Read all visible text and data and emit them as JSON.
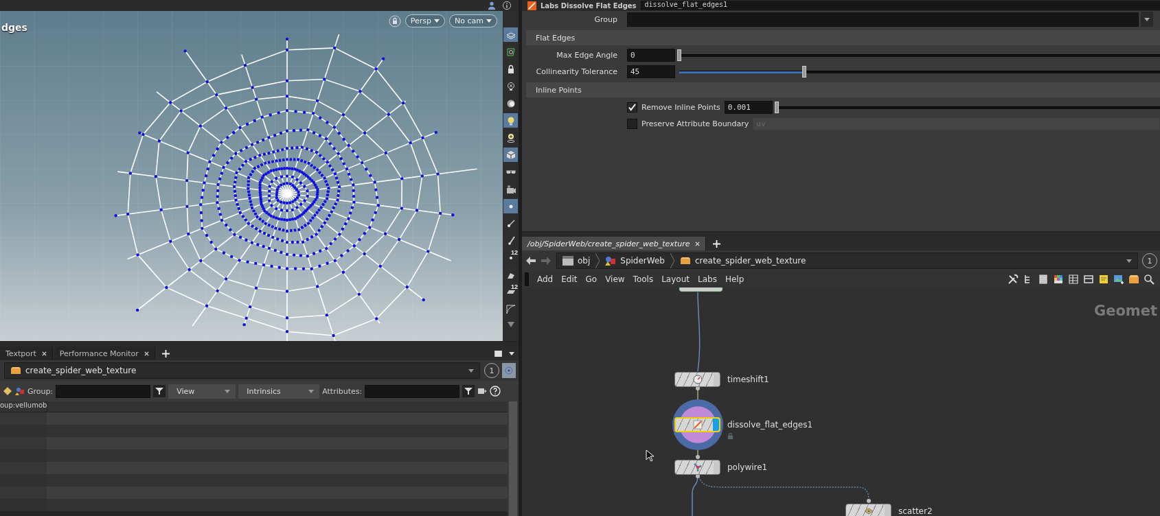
{
  "viewport": {
    "title": "dges",
    "view_menus": [
      {
        "label": "Persp"
      },
      {
        "label": "No cam"
      }
    ],
    "tools": [
      {
        "kind": "layers",
        "selected": true
      },
      {
        "kind": "snap",
        "selected": false
      },
      {
        "kind": "lock",
        "selected": false
      },
      {
        "kind": "bulb-x",
        "selected": false
      },
      {
        "kind": "sphere",
        "selected": false
      },
      {
        "kind": "bulb",
        "selected": true
      },
      {
        "kind": "bulb-plus",
        "selected": false
      },
      {
        "kind": "cube",
        "selected": true
      },
      {
        "kind": "glasses",
        "selected": false
      },
      {
        "kind": "camera",
        "selected": false
      },
      {
        "kind": "point",
        "selected": true
      },
      {
        "kind": "vertex",
        "selected": false
      },
      {
        "kind": "normal",
        "selected": false
      },
      {
        "kind": "point-numbers",
        "selected": false,
        "label": "12"
      },
      {
        "kind": "polygon",
        "selected": false
      },
      {
        "kind": "polygon-numbers",
        "selected": false,
        "label": "12"
      },
      {
        "kind": "curve",
        "selected": false
      }
    ]
  },
  "spreadsheet": {
    "tabs": [
      {
        "label": "Textport",
        "selected": false
      },
      {
        "label": "Performance Monitor",
        "selected": false
      }
    ],
    "path": "create_spider_web_texture",
    "badge": "1",
    "group_label": "Group:",
    "view_menu": "View",
    "intrinsics_menu": "Intrinsics",
    "attributes_label": "Attributes:",
    "columns": [
      "oup:vellumob"
    ]
  },
  "parameters": {
    "node_type": "Labs Dissolve Flat Edges",
    "node_name": "dissolve_flat_edges1",
    "group_label": "Group",
    "sections": [
      {
        "title": "Flat Edges",
        "params": [
          {
            "kind": "slider",
            "label": "Max Edge Angle",
            "value": "0",
            "level": 0
          },
          {
            "kind": "slider",
            "label": "Collinearity Tolerance",
            "value": "45",
            "level": 0.26
          }
        ]
      },
      {
        "title": "Inline Points",
        "params": [
          {
            "kind": "toggle_slider",
            "label": "Remove Inline Points",
            "checked": true,
            "value": "0.001",
            "level": 0
          },
          {
            "kind": "toggle_field",
            "label": "Preserve Attribute Boundary",
            "checked": false,
            "value": "uv"
          }
        ]
      }
    ]
  },
  "network": {
    "tabs": [
      {
        "label": "/obj/SpiderWeb/create_spider_web_texture",
        "selected": true
      }
    ],
    "path": [
      "obj",
      "SpiderWeb",
      "create_spider_web_texture"
    ],
    "badge": "1",
    "menu": [
      "Add",
      "Edit",
      "Go",
      "View",
      "Tools",
      "Layout",
      "Labs",
      "Help"
    ],
    "context_label": "Geomet",
    "nodes": [
      {
        "kind": "timeshift",
        "name": "timeshift1",
        "selected": false,
        "display": false,
        "locked": false
      },
      {
        "kind": "dissolve",
        "name": "dissolve_flat_edges1",
        "selected": true,
        "display": true,
        "locked": true
      },
      {
        "kind": "polywire",
        "name": "polywire1",
        "selected": false,
        "display": false,
        "locked": false
      },
      {
        "kind": "scatter",
        "name": "scatter2",
        "selected": false,
        "display": false,
        "locked": false
      }
    ]
  }
}
